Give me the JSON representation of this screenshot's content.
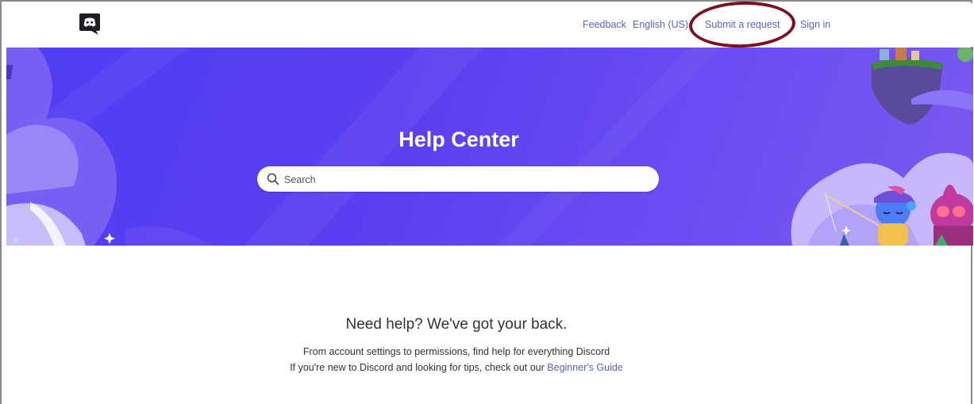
{
  "header": {
    "nav": {
      "feedback": "Feedback",
      "language": "English (US)",
      "submit_request": "Submit a request",
      "sign_in": "Sign in"
    }
  },
  "hero": {
    "title": "Help Center",
    "search_placeholder": "Search"
  },
  "main": {
    "tagline": "Need help? We've got your back.",
    "description_line1": "From account settings to permissions, find help for everything Discord",
    "description_line2_prefix": "If you're new to Discord and looking for tips, check out our ",
    "beginners_guide_link": "Beginner's Guide"
  },
  "colors": {
    "brand": "#5865F2",
    "link": "#5865C8",
    "annotation_ring": "#7A1020"
  },
  "icons": [
    "discord-logo-icon",
    "search-icon",
    "sparkle-icon"
  ]
}
